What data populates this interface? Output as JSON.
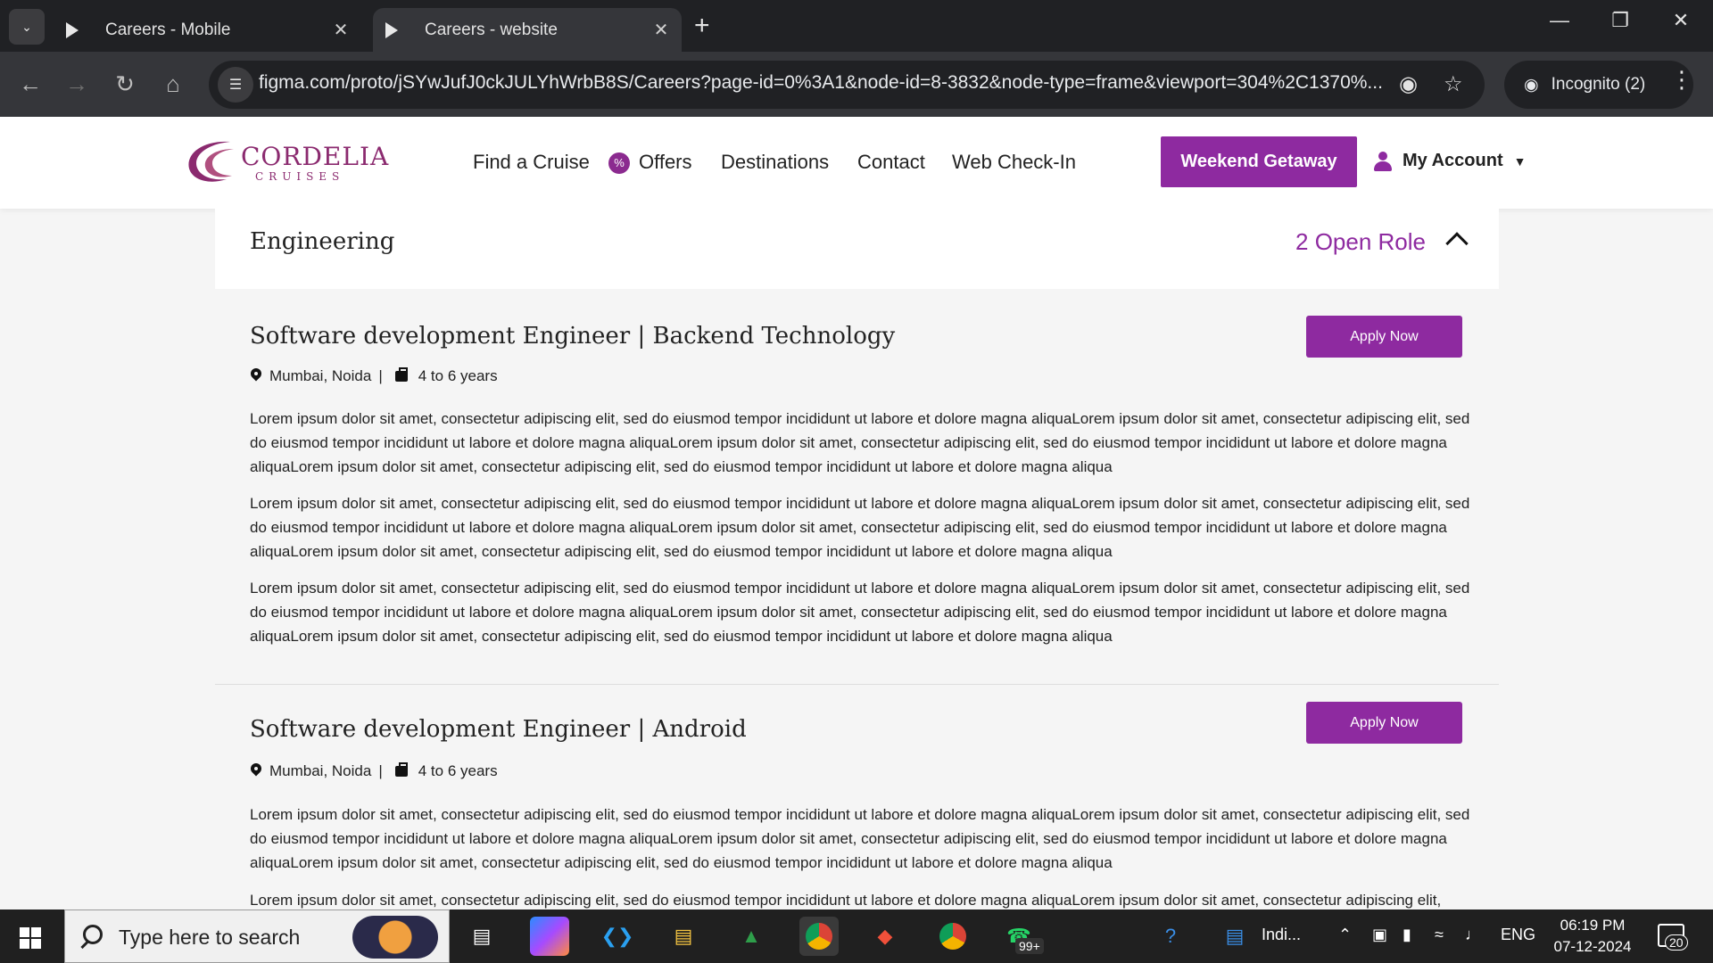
{
  "browser": {
    "tabs": [
      {
        "title": "Careers - Mobile",
        "active": false
      },
      {
        "title": "Careers - website",
        "active": true
      }
    ],
    "url": "figma.com/proto/jSYwJufJ0ckJULYhWrbB8S/Careers?page-id=0%3A1&node-id=8-3832&node-type=frame&viewport=304%2C1370%...",
    "incognito_label": "Incognito (2)"
  },
  "site": {
    "logo_main": "CORDELIA",
    "logo_sub": "CRUISES",
    "nav": [
      "Find a Cruise",
      "Offers",
      "Destinations",
      "Contact",
      "Web Check-In"
    ],
    "cta": "Weekend Getaway",
    "account": "My Account",
    "brand_color": "#8e2aa0"
  },
  "section": {
    "title": "Engineering",
    "roles": "2 Open Role"
  },
  "jobs": [
    {
      "title": "Software development Engineer | Backend Technology",
      "location": "Mumbai, Noida",
      "separator": "|",
      "experience": "4 to 6 years",
      "apply": "Apply Now",
      "paragraphs": [
        "Lorem ipsum dolor sit amet, consectetur adipiscing elit, sed do eiusmod tempor incididunt ut labore et dolore magna aliquaLorem ipsum dolor sit amet, consectetur adipiscing elit, sed do eiusmod tempor incididunt ut labore et dolore magna aliquaLorem ipsum dolor sit amet, consectetur adipiscing elit, sed do eiusmod tempor incididunt ut labore et dolore magna aliquaLorem ipsum dolor sit amet, consectetur adipiscing elit, sed do eiusmod tempor incididunt ut labore et dolore magna aliqua",
        "Lorem ipsum dolor sit amet, consectetur adipiscing elit, sed do eiusmod tempor incididunt ut labore et dolore magna aliquaLorem ipsum dolor sit amet, consectetur adipiscing elit, sed do eiusmod tempor incididunt ut labore et dolore magna aliquaLorem ipsum dolor sit amet, consectetur adipiscing elit, sed do eiusmod tempor incididunt ut labore et dolore magna aliquaLorem ipsum dolor sit amet, consectetur adipiscing elit, sed do eiusmod tempor incididunt ut labore et dolore magna aliqua",
        "Lorem ipsum dolor sit amet, consectetur adipiscing elit, sed do eiusmod tempor incididunt ut labore et dolore magna aliquaLorem ipsum dolor sit amet, consectetur adipiscing elit, sed do eiusmod tempor incididunt ut labore et dolore magna aliquaLorem ipsum dolor sit amet, consectetur adipiscing elit, sed do eiusmod tempor incididunt ut labore et dolore magna aliquaLorem ipsum dolor sit amet, consectetur adipiscing elit, sed do eiusmod tempor incididunt ut labore et dolore magna aliqua"
      ]
    },
    {
      "title": "Software development Engineer | Android",
      "location": "Mumbai, Noida",
      "separator": "|",
      "experience": "4 to 6 years",
      "apply": "Apply Now",
      "paragraphs": [
        "Lorem ipsum dolor sit amet, consectetur adipiscing elit, sed do eiusmod tempor incididunt ut labore et dolore magna aliquaLorem ipsum dolor sit amet, consectetur adipiscing elit, sed do eiusmod tempor incididunt ut labore et dolore magna aliquaLorem ipsum dolor sit amet, consectetur adipiscing elit, sed do eiusmod tempor incididunt ut labore et dolore magna aliquaLorem ipsum dolor sit amet, consectetur adipiscing elit, sed do eiusmod tempor incididunt ut labore et dolore magna aliqua",
        "Lorem ipsum dolor sit amet, consectetur adipiscing elit, sed do eiusmod tempor incididunt ut labore et dolore magna aliquaLorem ipsum dolor sit amet, consectetur adipiscing elit,"
      ]
    }
  ],
  "taskbar": {
    "search_placeholder": "Type here to search",
    "whatsapp_badge": "99+",
    "pinned_label": "Indi...",
    "language": "ENG",
    "time": "06:19 PM",
    "date": "07-12-2024",
    "notifications": "20"
  }
}
